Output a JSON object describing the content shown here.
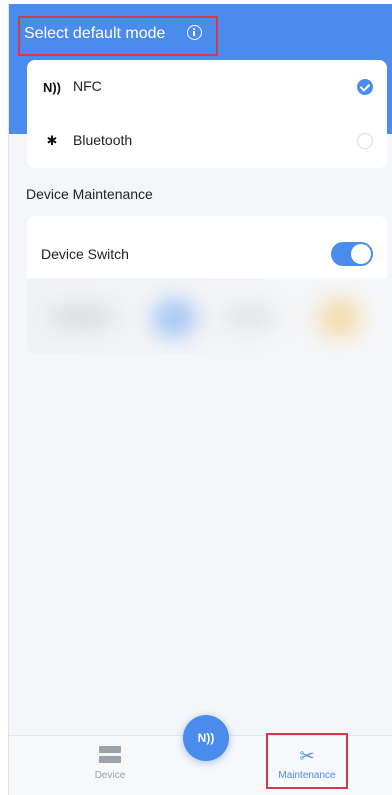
{
  "header": {
    "title": "Select default mode",
    "info_icon": "info-circle-icon"
  },
  "mode_options": [
    {
      "icon": "nfc-icon",
      "icon_glyph": "N))",
      "label": "NFC",
      "selected": true
    },
    {
      "icon": "bluetooth-icon",
      "icon_glyph": "✱",
      "label": "Bluetooth",
      "selected": false
    }
  ],
  "maintenance": {
    "section_title": "Device Maintenance",
    "switch_label": "Device Switch",
    "switch_on": true
  },
  "fab": {
    "icon": "nfc-icon",
    "glyph": "N))"
  },
  "tabbar": {
    "tabs": [
      {
        "label": "Device",
        "icon": "device-icon",
        "active": false
      },
      {
        "label": "Maintenance",
        "icon": "tools-icon",
        "glyph": "✂",
        "active": true
      }
    ]
  },
  "colors": {
    "accent": "#4a8cec",
    "highlight_box": "#d33a4a",
    "inactive": "#9aa2ac"
  }
}
